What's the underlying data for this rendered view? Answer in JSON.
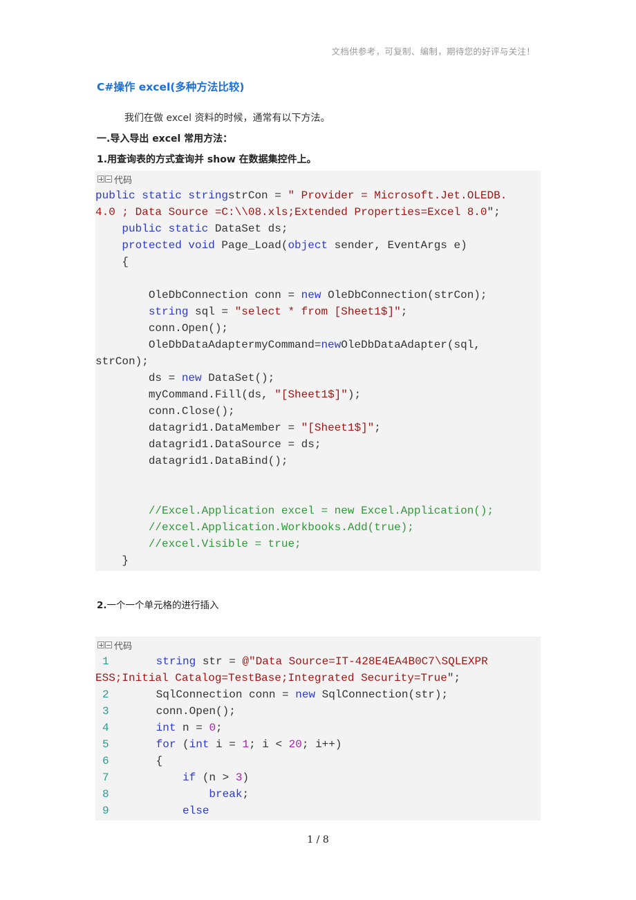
{
  "header_note": "文档供参考，可复制、编制，期待您的好评与关注！",
  "title": "C#操作 excel(多种方法比较)",
  "intro": "我们在做 excel 资料的时候，通常有以下方法。",
  "section1": "一.导入导出 excel 常用方法：",
  "subsection1": {
    "num": "1.",
    "text": "用查询表的方式查询并 show 在数据集控件上。"
  },
  "subsection2": {
    "num": "2.",
    "text": "一个一个单元格的进行插入"
  },
  "code_toggle": {
    "expand_icon": "plus-box-icon",
    "collapse_icon": "minus-box-icon",
    "label": "代码"
  },
  "code_block_1": {
    "lines": [
      [
        [
          "kw",
          "public static string"
        ],
        [
          "",
          "strCon = "
        ],
        [
          "str",
          "\" Provider = Microsoft.Jet.OLEDB."
        ]
      ],
      [
        [
          "str",
          "4.0 ; Data Source =C:\\\\08.xls;Extended Properties=Excel 8.0"
        ],
        [
          "",
          "\";"
        ]
      ],
      [
        [
          "",
          "    "
        ],
        [
          "kw",
          "public static"
        ],
        [
          "",
          " DataSet ds;"
        ]
      ],
      [
        [
          "",
          "    "
        ],
        [
          "kw",
          "protected void"
        ],
        [
          "",
          " Page_Load("
        ],
        [
          "kw",
          "object"
        ],
        [
          "",
          " sender, EventArgs e)"
        ]
      ],
      [
        [
          "",
          "    {"
        ]
      ],
      [
        [
          "",
          ""
        ]
      ],
      [
        [
          "",
          "        OleDbConnection conn = "
        ],
        [
          "kw",
          "new"
        ],
        [
          "",
          " OleDbConnection(strCon);"
        ]
      ],
      [
        [
          "",
          "        "
        ],
        [
          "kw",
          "string"
        ],
        [
          "",
          " sql = "
        ],
        [
          "str",
          "\"select * from [Sheet1$]\""
        ],
        [
          "",
          ";"
        ]
      ],
      [
        [
          "",
          "        conn.Open();"
        ]
      ],
      [
        [
          "",
          "        OleDbDataAdaptermyCommand="
        ],
        [
          "kw",
          "new"
        ],
        [
          "",
          "OleDbDataAdapter(sql,"
        ]
      ],
      [
        [
          "",
          "strCon);"
        ]
      ],
      [
        [
          "",
          "        ds = "
        ],
        [
          "kw",
          "new"
        ],
        [
          "",
          " DataSet();"
        ]
      ],
      [
        [
          "",
          "        myCommand.Fill(ds, "
        ],
        [
          "str",
          "\"[Sheet1$]\""
        ],
        [
          "",
          ");"
        ]
      ],
      [
        [
          "",
          "        conn.Close();"
        ]
      ],
      [
        [
          "",
          "        datagrid1.DataMember = "
        ],
        [
          "str",
          "\"[Sheet1$]\""
        ],
        [
          "",
          ";"
        ]
      ],
      [
        [
          "",
          "        datagrid1.DataSource = ds;"
        ]
      ],
      [
        [
          "",
          "        datagrid1.DataBind();"
        ]
      ],
      [
        [
          "",
          ""
        ]
      ],
      [
        [
          "",
          ""
        ]
      ],
      [
        [
          "cm",
          "        //Excel.Application excel = new Excel.Application();"
        ]
      ],
      [
        [
          "cm",
          "        //excel.Application.Workbooks.Add(true);"
        ]
      ],
      [
        [
          "cm",
          "        //excel.Visible = true;"
        ]
      ],
      [
        [
          "",
          "    }"
        ]
      ]
    ]
  },
  "code_block_2": {
    "lines": [
      {
        "n": "1",
        "seg": [
          [
            "",
            "      "
          ],
          [
            "kw",
            "string"
          ],
          [
            "",
            " str = "
          ],
          [
            "str",
            "@\"Data Source=IT-428E4EA4B0C7\\SQLEXPR"
          ]
        ]
      },
      {
        "n": "",
        "seg": [
          [
            "str",
            "ESS;Initial Catalog=TestBase;Integrated Security=True"
          ],
          [
            "",
            "\";"
          ]
        ]
      },
      {
        "n": "2",
        "seg": [
          [
            "",
            "      SqlConnection conn = "
          ],
          [
            "kw",
            "new"
          ],
          [
            "",
            " SqlConnection(str);"
          ]
        ]
      },
      {
        "n": "3",
        "seg": [
          [
            "",
            "      conn.Open();"
          ]
        ]
      },
      {
        "n": "4",
        "seg": [
          [
            "",
            "      "
          ],
          [
            "kw",
            "int"
          ],
          [
            "",
            " n = "
          ],
          [
            "num",
            "0"
          ],
          [
            "",
            ";"
          ]
        ]
      },
      {
        "n": "5",
        "seg": [
          [
            "",
            "      "
          ],
          [
            "kw",
            "for"
          ],
          [
            "",
            " ("
          ],
          [
            "kw",
            "int"
          ],
          [
            "",
            " i = "
          ],
          [
            "num",
            "1"
          ],
          [
            "",
            "; i < "
          ],
          [
            "num",
            "20"
          ],
          [
            "",
            "; i++)"
          ]
        ]
      },
      {
        "n": "6",
        "seg": [
          [
            "",
            "      {"
          ]
        ]
      },
      {
        "n": "7",
        "seg": [
          [
            "",
            "          "
          ],
          [
            "kw",
            "if"
          ],
          [
            "",
            " (n > "
          ],
          [
            "num",
            "3"
          ],
          [
            "",
            ")"
          ]
        ]
      },
      {
        "n": "8",
        "seg": [
          [
            "",
            "              "
          ],
          [
            "kw",
            "break"
          ],
          [
            "",
            ";"
          ]
        ]
      },
      {
        "n": "9",
        "seg": [
          [
            "",
            "          "
          ],
          [
            "kw",
            "else"
          ]
        ]
      }
    ]
  },
  "footer": {
    "page": "1",
    "sep": " / ",
    "total": "8"
  }
}
